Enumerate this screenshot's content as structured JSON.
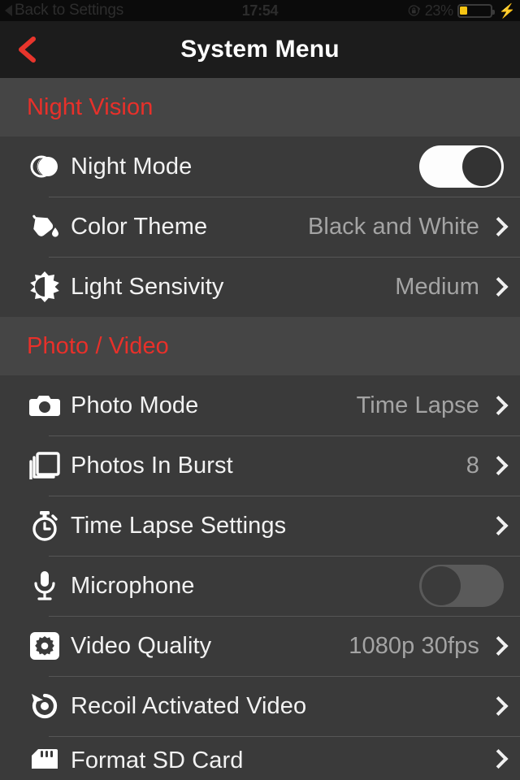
{
  "status_bar": {
    "back_label": "Back to Settings",
    "back_icon": "triangle-left-icon",
    "time": "17:54",
    "lock_icon": "rotation-lock-icon",
    "battery_percent": "23%",
    "battery_level": 23,
    "battery_color": "#f5c413",
    "charging_icon": "lightning-bolt-icon"
  },
  "navbar": {
    "back_icon": "chevron-left-icon",
    "title": "System Menu",
    "accent_color": "#e8302a",
    "background": "#1c1c1c"
  },
  "theme": {
    "section_header_bg": "#454545",
    "row_bg": "#3a3a3a",
    "divider": "#565656",
    "label_color": "#f2f2f2",
    "value_color": "#a4a4a4",
    "accent_red": "#e8302a"
  },
  "sections": [
    {
      "title": "Night Vision",
      "rows": [
        {
          "icon": "moon-icon",
          "label": "Night Mode",
          "control": "toggle",
          "toggle_state": "on"
        },
        {
          "icon": "paint-bucket-icon",
          "label": "Color Theme",
          "value": "Black and White",
          "control": "chevron"
        },
        {
          "icon": "brightness-icon",
          "label": "Light Sensivity",
          "value": "Medium",
          "control": "chevron"
        }
      ]
    },
    {
      "title": "Photo / Video",
      "rows": [
        {
          "icon": "camera-icon",
          "label": "Photo Mode",
          "value": "Time Lapse",
          "control": "chevron"
        },
        {
          "icon": "photo-stack-icon",
          "label": "Photos In Burst",
          "value": "8",
          "control": "chevron"
        },
        {
          "icon": "stopwatch-icon",
          "label": "Time Lapse Settings",
          "value": "",
          "control": "chevron"
        },
        {
          "icon": "microphone-icon",
          "label": "Microphone",
          "control": "toggle",
          "toggle_state": "off"
        },
        {
          "icon": "gear-square-icon",
          "label": "Video Quality",
          "value": "1080p 30fps",
          "control": "chevron"
        },
        {
          "icon": "rotate-back-icon",
          "label": "Recoil Activated Video",
          "value": "",
          "control": "chevron"
        },
        {
          "icon": "sd-card-icon",
          "label": "Format SD Card",
          "value": "",
          "control": "chevron",
          "clipped": true
        }
      ]
    }
  ]
}
